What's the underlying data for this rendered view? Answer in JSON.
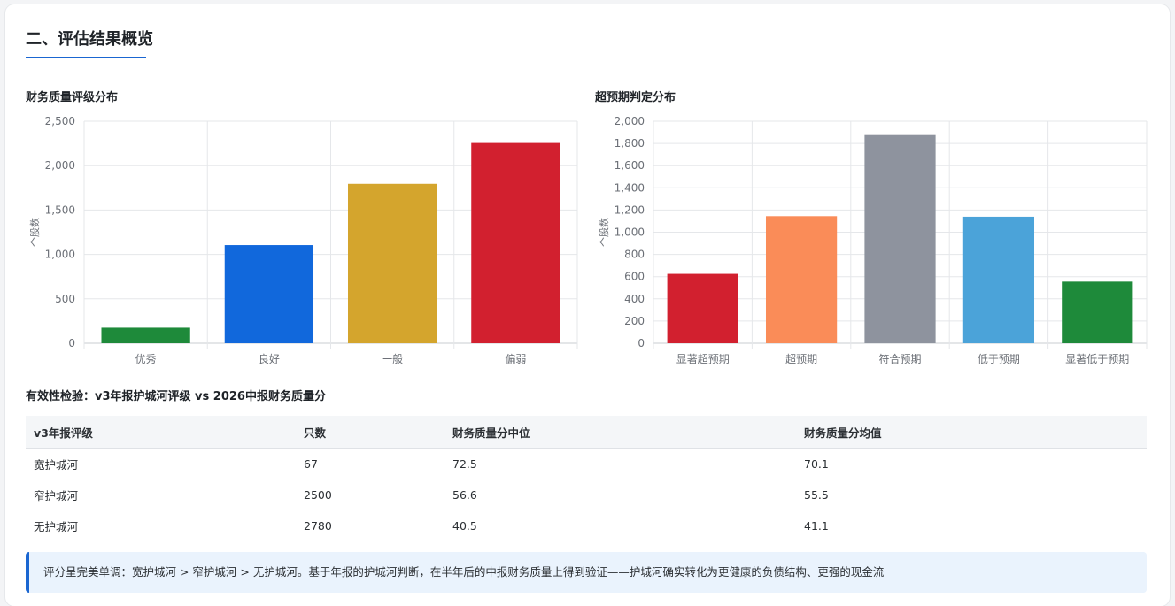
{
  "section_title": "二、评估结果概览",
  "chart_data": [
    {
      "type": "bar",
      "title": "财务质量评级分布",
      "ylabel": "个股数",
      "categories": [
        "优秀",
        "良好",
        "一般",
        "偏弱"
      ],
      "values": [
        175,
        1105,
        1795,
        2255
      ],
      "colors": [
        "#1e8a3a",
        "#1168dc",
        "#d4a52d",
        "#d2202f"
      ],
      "ylim": [
        0,
        2500
      ],
      "yticks": [
        0,
        500,
        1000,
        1500,
        2000,
        2500
      ],
      "ytick_labels": [
        "0",
        "500",
        "1,000",
        "1,500",
        "2,000",
        "2,500"
      ],
      "grid": true
    },
    {
      "type": "bar",
      "title": "超预期判定分布",
      "ylabel": "个股数",
      "categories": [
        "显著超预期",
        "超预期",
        "符合预期",
        "低于预期",
        "显著低于预期"
      ],
      "values": [
        625,
        1145,
        1875,
        1140,
        555
      ],
      "colors": [
        "#d2202f",
        "#fa8c58",
        "#8e939e",
        "#4ba3d9",
        "#1e8a3a"
      ],
      "ylim": [
        0,
        2000
      ],
      "yticks": [
        0,
        200,
        400,
        600,
        800,
        1000,
        1200,
        1400,
        1600,
        1800,
        2000
      ],
      "ytick_labels": [
        "0",
        "200",
        "400",
        "600",
        "800",
        "1,000",
        "1,200",
        "1,400",
        "1,600",
        "1,800",
        "2,000"
      ],
      "grid": true
    }
  ],
  "validity": {
    "title": "有效性检验：v3年报护城河评级 vs 2026中报财务质量分",
    "headers": [
      "v3年报评级",
      "只数",
      "财务质量分中位",
      "财务质量分均值"
    ],
    "rows": [
      [
        "宽护城河",
        "67",
        "72.5",
        "70.1"
      ],
      [
        "窄护城河",
        "2500",
        "56.6",
        "55.5"
      ],
      [
        "无护城河",
        "2780",
        "40.5",
        "41.1"
      ]
    ]
  },
  "note": "评分呈完美单调：宽护城河 > 窄护城河 > 无护城河。基于年报的护城河判断，在半年后的中报财务质量上得到验证——护城河确实转化为更健康的负债结构、更强的现金流"
}
